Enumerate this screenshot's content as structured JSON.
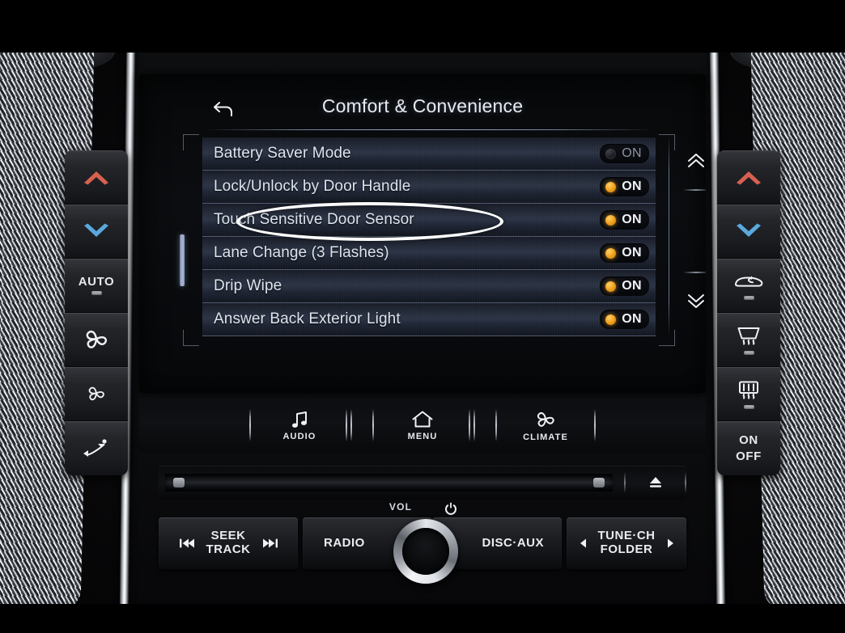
{
  "screen": {
    "title": "Comfort & Convenience",
    "back_icon": "back-arrow-icon",
    "scroll_up_icon": "double-chevron-up-icon",
    "scroll_down_icon": "double-chevron-down-icon",
    "annotation": "Touch Sensitive Door Sensor",
    "settings": [
      {
        "label": "Battery Saver Mode",
        "state": "ON",
        "enabled": false
      },
      {
        "label": "Lock/Unlock by Door Handle",
        "state": "ON",
        "enabled": true
      },
      {
        "label": "Touch Sensitive Door Sensor",
        "state": "ON",
        "enabled": true
      },
      {
        "label": "Lane Change (3 Flashes)",
        "state": "ON",
        "enabled": true
      },
      {
        "label": "Drip Wipe",
        "state": "ON",
        "enabled": true
      },
      {
        "label": "Answer Back Exterior Light",
        "state": "ON",
        "enabled": true
      }
    ]
  },
  "hardkeys": [
    {
      "label": "AUDIO",
      "icon": "music-note-icon"
    },
    {
      "label": "MENU",
      "icon": "home-icon"
    },
    {
      "label": "CLIMATE",
      "icon": "fan-icon"
    }
  ],
  "media_bar": {
    "eject_icon": "eject-icon",
    "seek_label_line1": "SEEK",
    "seek_label_line2": "TRACK",
    "prev_icon": "previous-track-icon",
    "next_icon": "next-track-icon",
    "radio_label": "RADIO",
    "disc_aux_label": "DISC·AUX",
    "tune_label_line1": "TUNE·CH",
    "tune_label_line2": "FOLDER",
    "tune_prev_icon": "left-triangle-icon",
    "tune_next_icon": "right-triangle-icon",
    "vol_label": "VOL",
    "power_icon": "power-icon"
  },
  "hvac_left": [
    {
      "name": "temp-up",
      "icon": "chevron-up-red-icon",
      "label": ""
    },
    {
      "name": "temp-down",
      "icon": "chevron-down-blue-icon",
      "label": ""
    },
    {
      "name": "auto",
      "icon": "",
      "label": "AUTO"
    },
    {
      "name": "fan-up",
      "icon": "fan-large-icon",
      "label": ""
    },
    {
      "name": "fan-down",
      "icon": "fan-small-icon",
      "label": ""
    },
    {
      "name": "airflow-mode",
      "icon": "seat-airflow-icon",
      "label": ""
    }
  ],
  "hvac_right": [
    {
      "name": "temp-up",
      "icon": "chevron-up-red-icon",
      "label": ""
    },
    {
      "name": "temp-down",
      "icon": "chevron-down-blue-icon",
      "label": ""
    },
    {
      "name": "recirculation",
      "icon": "recirculation-icon",
      "label": ""
    },
    {
      "name": "front-defrost",
      "icon": "front-defrost-icon",
      "label": ""
    },
    {
      "name": "rear-defrost",
      "icon": "rear-defrost-icon",
      "label": ""
    },
    {
      "name": "power-on-off",
      "icon": "",
      "label": "ON\nOFF",
      "label_line1": "ON",
      "label_line2": "OFF"
    }
  ],
  "colors": {
    "accent_on": "#f5a623",
    "screen_text": "#dde4ee",
    "temp_up": "#d9604f",
    "temp_down": "#5aa8dd",
    "annotation": "#ffffff"
  }
}
